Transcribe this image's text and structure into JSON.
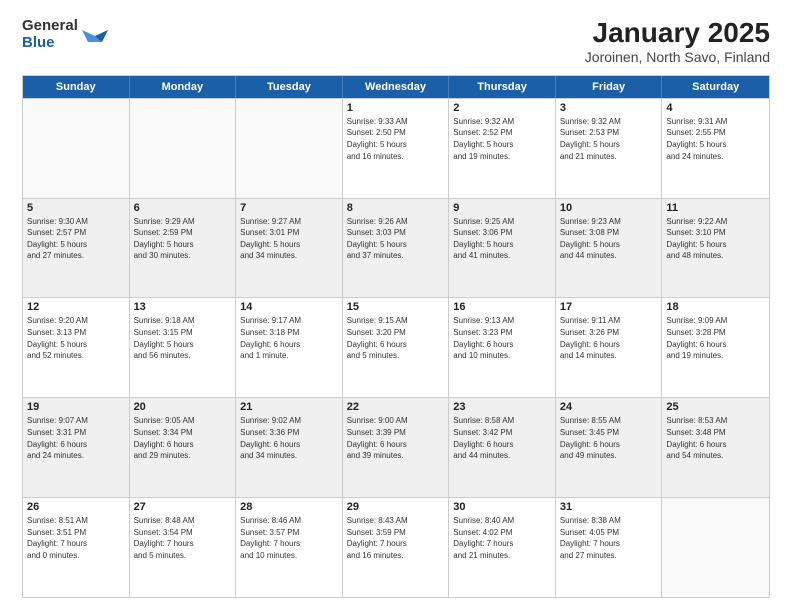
{
  "logo": {
    "general": "General",
    "blue": "Blue"
  },
  "title": "January 2025",
  "subtitle": "Joroinen, North Savo, Finland",
  "days": [
    "Sunday",
    "Monday",
    "Tuesday",
    "Wednesday",
    "Thursday",
    "Friday",
    "Saturday"
  ],
  "weeks": [
    [
      {
        "day": "",
        "empty": true
      },
      {
        "day": "",
        "empty": true
      },
      {
        "day": "",
        "empty": true
      },
      {
        "day": "1",
        "info": "Sunrise: 9:33 AM\nSunset: 2:50 PM\nDaylight: 5 hours\nand 16 minutes."
      },
      {
        "day": "2",
        "info": "Sunrise: 9:32 AM\nSunset: 2:52 PM\nDaylight: 5 hours\nand 19 minutes."
      },
      {
        "day": "3",
        "info": "Sunrise: 9:32 AM\nSunset: 2:53 PM\nDaylight: 5 hours\nand 21 minutes."
      },
      {
        "day": "4",
        "info": "Sunrise: 9:31 AM\nSunset: 2:55 PM\nDaylight: 5 hours\nand 24 minutes."
      }
    ],
    [
      {
        "day": "5",
        "info": "Sunrise: 9:30 AM\nSunset: 2:57 PM\nDaylight: 5 hours\nand 27 minutes."
      },
      {
        "day": "6",
        "info": "Sunrise: 9:29 AM\nSunset: 2:59 PM\nDaylight: 5 hours\nand 30 minutes."
      },
      {
        "day": "7",
        "info": "Sunrise: 9:27 AM\nSunset: 3:01 PM\nDaylight: 5 hours\nand 34 minutes."
      },
      {
        "day": "8",
        "info": "Sunrise: 9:26 AM\nSunset: 3:03 PM\nDaylight: 5 hours\nand 37 minutes."
      },
      {
        "day": "9",
        "info": "Sunrise: 9:25 AM\nSunset: 3:06 PM\nDaylight: 5 hours\nand 41 minutes."
      },
      {
        "day": "10",
        "info": "Sunrise: 9:23 AM\nSunset: 3:08 PM\nDaylight: 5 hours\nand 44 minutes."
      },
      {
        "day": "11",
        "info": "Sunrise: 9:22 AM\nSunset: 3:10 PM\nDaylight: 5 hours\nand 48 minutes."
      }
    ],
    [
      {
        "day": "12",
        "info": "Sunrise: 9:20 AM\nSunset: 3:13 PM\nDaylight: 5 hours\nand 52 minutes."
      },
      {
        "day": "13",
        "info": "Sunrise: 9:18 AM\nSunset: 3:15 PM\nDaylight: 5 hours\nand 56 minutes."
      },
      {
        "day": "14",
        "info": "Sunrise: 9:17 AM\nSunset: 3:18 PM\nDaylight: 6 hours\nand 1 minute."
      },
      {
        "day": "15",
        "info": "Sunrise: 9:15 AM\nSunset: 3:20 PM\nDaylight: 6 hours\nand 5 minutes."
      },
      {
        "day": "16",
        "info": "Sunrise: 9:13 AM\nSunset: 3:23 PM\nDaylight: 6 hours\nand 10 minutes."
      },
      {
        "day": "17",
        "info": "Sunrise: 9:11 AM\nSunset: 3:26 PM\nDaylight: 6 hours\nand 14 minutes."
      },
      {
        "day": "18",
        "info": "Sunrise: 9:09 AM\nSunset: 3:28 PM\nDaylight: 6 hours\nand 19 minutes."
      }
    ],
    [
      {
        "day": "19",
        "info": "Sunrise: 9:07 AM\nSunset: 3:31 PM\nDaylight: 6 hours\nand 24 minutes."
      },
      {
        "day": "20",
        "info": "Sunrise: 9:05 AM\nSunset: 3:34 PM\nDaylight: 6 hours\nand 29 minutes."
      },
      {
        "day": "21",
        "info": "Sunrise: 9:02 AM\nSunset: 3:36 PM\nDaylight: 6 hours\nand 34 minutes."
      },
      {
        "day": "22",
        "info": "Sunrise: 9:00 AM\nSunset: 3:39 PM\nDaylight: 6 hours\nand 39 minutes."
      },
      {
        "day": "23",
        "info": "Sunrise: 8:58 AM\nSunset: 3:42 PM\nDaylight: 6 hours\nand 44 minutes."
      },
      {
        "day": "24",
        "info": "Sunrise: 8:55 AM\nSunset: 3:45 PM\nDaylight: 6 hours\nand 49 minutes."
      },
      {
        "day": "25",
        "info": "Sunrise: 8:53 AM\nSunset: 3:48 PM\nDaylight: 6 hours\nand 54 minutes."
      }
    ],
    [
      {
        "day": "26",
        "info": "Sunrise: 8:51 AM\nSunset: 3:51 PM\nDaylight: 7 hours\nand 0 minutes."
      },
      {
        "day": "27",
        "info": "Sunrise: 8:48 AM\nSunset: 3:54 PM\nDaylight: 7 hours\nand 5 minutes."
      },
      {
        "day": "28",
        "info": "Sunrise: 8:46 AM\nSunset: 3:57 PM\nDaylight: 7 hours\nand 10 minutes."
      },
      {
        "day": "29",
        "info": "Sunrise: 8:43 AM\nSunset: 3:59 PM\nDaylight: 7 hours\nand 16 minutes."
      },
      {
        "day": "30",
        "info": "Sunrise: 8:40 AM\nSunset: 4:02 PM\nDaylight: 7 hours\nand 21 minutes."
      },
      {
        "day": "31",
        "info": "Sunrise: 8:38 AM\nSunset: 4:05 PM\nDaylight: 7 hours\nand 27 minutes."
      },
      {
        "day": "",
        "empty": true
      }
    ]
  ]
}
